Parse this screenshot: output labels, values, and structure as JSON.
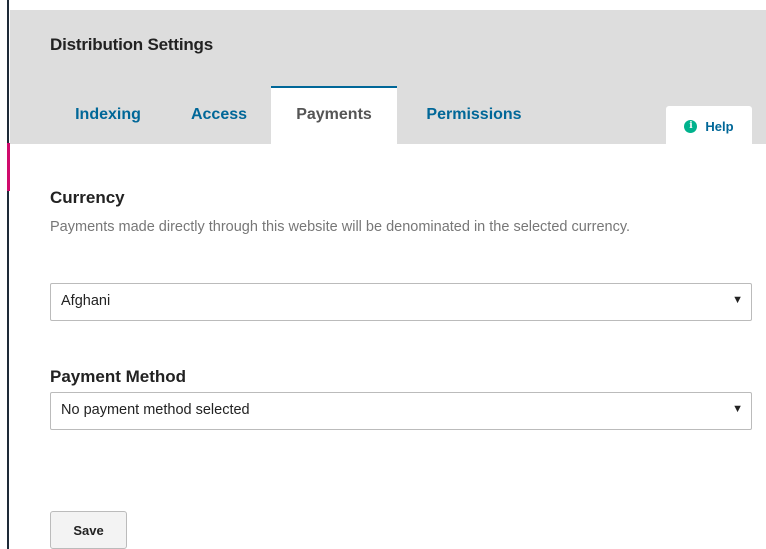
{
  "page": {
    "title": "Distribution Settings"
  },
  "tabs": [
    {
      "label": "Indexing",
      "active": false
    },
    {
      "label": "Access",
      "active": false
    },
    {
      "label": "Payments",
      "active": true
    },
    {
      "label": "Permissions",
      "active": false
    }
  ],
  "help": {
    "icon": "info-icon",
    "icon_glyph": "i",
    "label": "Help"
  },
  "currency": {
    "title": "Currency",
    "description": "Payments made directly through this website will be denominated in the selected currency.",
    "selected": "Afghani",
    "arrow": "▼"
  },
  "payment_method": {
    "title": "Payment Method",
    "selected": "No payment method selected",
    "arrow": "▼"
  },
  "actions": {
    "save_label": "Save"
  },
  "colors": {
    "accent": "#006798",
    "sidebar_accent": "#d00a6c",
    "help_icon": "#00b28d",
    "header_bg": "#dddddd"
  }
}
